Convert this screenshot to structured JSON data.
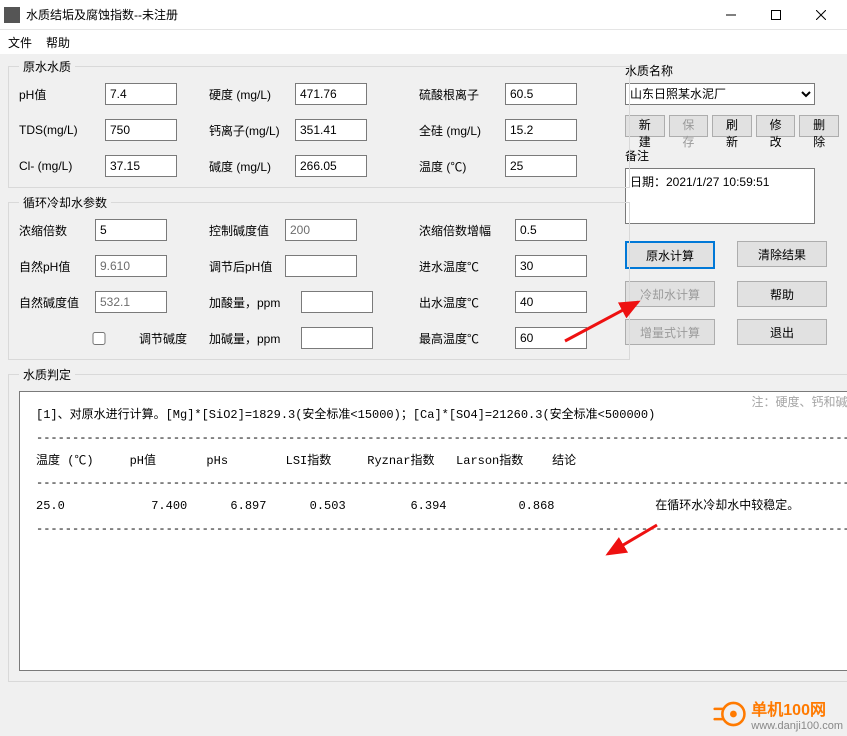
{
  "window": {
    "title": "水质结垢及腐蚀指数--未注册"
  },
  "menu": {
    "file": "文件",
    "help": "帮助"
  },
  "raw": {
    "legend": "原水水质",
    "ph_label": "pH值",
    "ph": "7.4",
    "tds_label": "TDS(mg/L)",
    "tds": "750",
    "cl_label": "Cl-  (mg/L)",
    "cl": "37.15",
    "hard_label": "硬度 (mg/L)",
    "hard": "471.76",
    "ca_label": "钙离子(mg/L)",
    "ca": "351.41",
    "alk_label": "碱度 (mg/L)",
    "alk": "266.05",
    "so4_label": "硫酸根离子",
    "so4": "60.5",
    "si_label": "全硅 (mg/L)",
    "si": "15.2",
    "temp_label": "温度 (℃)",
    "temp": "25"
  },
  "cycle": {
    "legend": "循环冷却水参数",
    "conc_label": "浓缩倍数",
    "conc": "5",
    "natph_label": "自然pH值",
    "natph": "9.610",
    "natalk_label": "自然碱度值",
    "natalk": "532.1",
    "ctrlalk_label": "控制碱度值",
    "ctrlalk": "200",
    "adjph_label": "调节后pH值",
    "adjph": "",
    "acid_label": "加酸量，ppm",
    "acid": "",
    "addalk_label": "加碱量，ppm",
    "addalk": "",
    "adjalk_chk": "调节碱度",
    "concstep_label": "浓缩倍数增幅",
    "concstep": "0.5",
    "tin_label": "进水温度℃",
    "tin": "30",
    "tout_label": "出水温度℃",
    "tout": "40",
    "tmax_label": "最高温度℃",
    "tmax": "60"
  },
  "right": {
    "name_label": "水质名称",
    "name_value": "山东日照某水泥厂",
    "btn_new": "新建",
    "btn_save": "保存",
    "btn_refresh": "刷新",
    "btn_modify": "修改",
    "btn_delete": "删除",
    "note_label": "备注",
    "note_value": "日期：2021/1/27 10:59:51",
    "btn_rawcalc": "原水计算",
    "btn_clear": "清除结果",
    "btn_cycalc": "冷却水计算",
    "btn_help": "帮助",
    "btn_inccalc": "增量式计算",
    "btn_exit": "退出"
  },
  "result": {
    "legend": "水质判定",
    "note": "注：硬度、钙和碱度均以碳酸钙计",
    "text": "[1]、对原水进行计算。[Mg]*[SiO2]=1829.3(安全标准<15000)；[Ca]*[SO4]=21260.3(安全标准<500000)\n--------------------------------------------------------------------------------------------------------------------------\n温度 (℃)     pH值       pHs        LSI指数     Ryznar指数   Larson指数    结论\n--------------------------------------------------------------------------------------------------------------------------\n25.0            7.400      6.897      0.503         6.394          0.868              在循环水冷却水中较稳定。\n--------------------------------------------------------------------------------------------------------------------------"
  },
  "watermark": {
    "name": "单机100网",
    "url": "www.danji100.com"
  }
}
